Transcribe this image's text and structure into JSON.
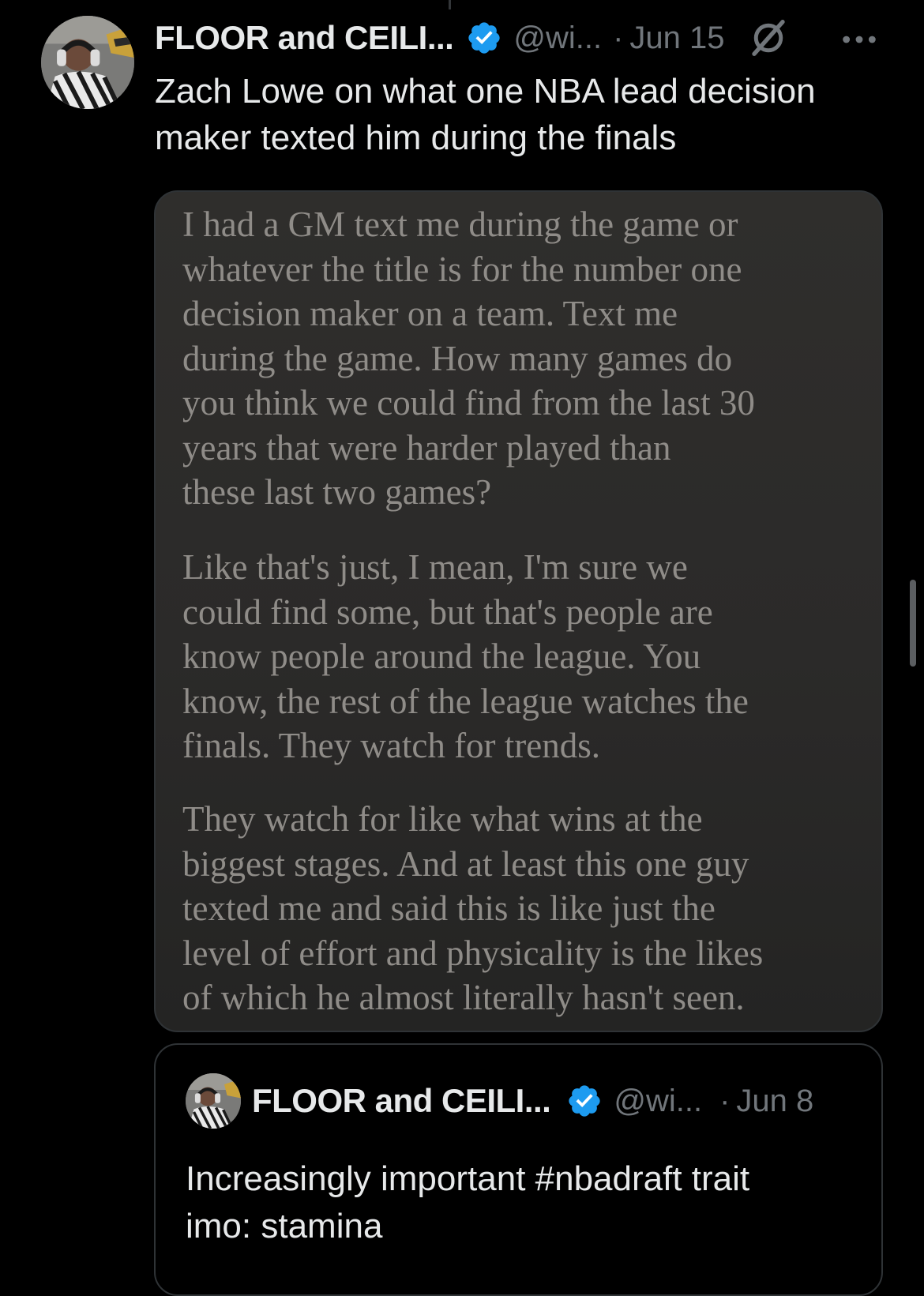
{
  "tweet": {
    "display_name": "FLOOR and CEILI...",
    "handle": "@wi...",
    "separator": "·",
    "date": "Jun 15",
    "text_lines": [
      "Zach Lowe on what one NBA lead decision",
      "maker texted him during the finals"
    ],
    "icons": {
      "avatar": "profile-avatar",
      "verified": "verified-badge-icon",
      "grok": "grok-icon",
      "more": "more-options-icon"
    }
  },
  "media": {
    "paragraphs": [
      [
        "I had a GM text me during the game or",
        "whatever the title is for the number one",
        "decision maker on a team. Text me",
        "during the game. How many games do",
        "you think we could find from the last 30",
        "years that were harder played than",
        "these last two games?"
      ],
      [
        "Like that's just, I mean, I'm sure we",
        "could find some, but that's people are",
        "know people around the league. You",
        "know, the rest of the league watches the",
        "finals. They watch for trends."
      ],
      [
        "They watch for like what wins at the",
        "biggest stages. And at least this one guy",
        "texted me and said this is like just the",
        "level of effort and physicality is the likes",
        "of which he almost literally hasn't seen."
      ]
    ]
  },
  "quoted_tweet": {
    "display_name": "FLOOR and CEILI...",
    "handle": "@wi...",
    "separator": "·",
    "date": "Jun 8",
    "text_lines": [
      "Increasingly important #nbadraft trait",
      "imo: stamina"
    ]
  },
  "colors": {
    "background": "#000000",
    "primary_text": "#e7e9ea",
    "secondary_text": "#71767b",
    "verified_blue": "#1d9bf0",
    "border": "#2f3336",
    "media_text": "#8f8c88"
  }
}
